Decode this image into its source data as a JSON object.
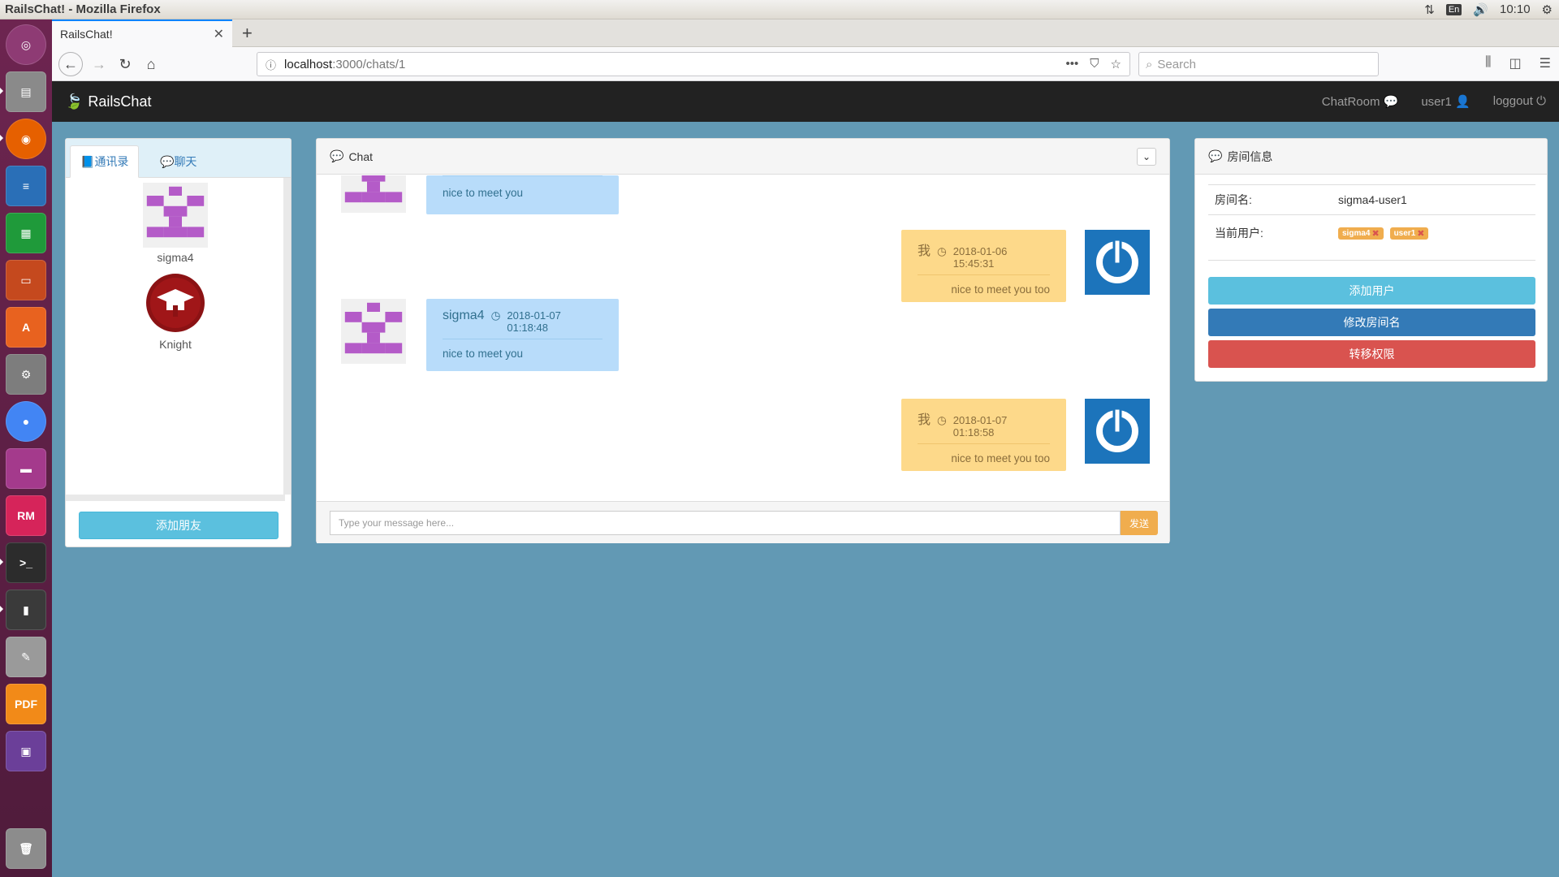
{
  "system": {
    "window_title": "RailsChat! - Mozilla Firefox",
    "lang": "En",
    "clock": "10:10"
  },
  "browser": {
    "tab_title": "RailsChat!",
    "url_host": "localhost",
    "url_path": ":3000/chats/1",
    "search_placeholder": "Search"
  },
  "app": {
    "brand": "RailsChat",
    "nav": {
      "chatroom": "ChatRoom",
      "user": "user1",
      "logout": "loggout"
    }
  },
  "left_panel": {
    "tabs": [
      "通讯录",
      "聊天"
    ],
    "contacts": [
      {
        "name": "sigma4"
      },
      {
        "name": "Knight"
      }
    ],
    "add_friend": "添加朋友"
  },
  "chat": {
    "title": "Chat",
    "messages": [
      {
        "side": "left",
        "name": "",
        "time": "",
        "text": "nice to meet you"
      },
      {
        "side": "right",
        "name": "我",
        "time": "2018-01-06 15:45:31",
        "text": "nice to meet you too"
      },
      {
        "side": "left",
        "name": "sigma4",
        "time": "2018-01-07 01:18:48",
        "text": "nice to meet you"
      },
      {
        "side": "right",
        "name": "我",
        "time": "2018-01-07 01:18:58",
        "text": "nice to meet you too"
      }
    ],
    "input_placeholder": "Type your message here...",
    "send": "发送"
  },
  "room": {
    "title": "房间信息",
    "name_label": "房间名:",
    "name_value": "sigma4-user1",
    "users_label": "当前用户:",
    "users": [
      "sigma4",
      "user1"
    ],
    "buttons": {
      "add_user": "添加用户",
      "rename": "修改房间名",
      "transfer": "转移权限"
    }
  },
  "colors": {
    "info": "#5bc0de",
    "primary": "#337ab7",
    "danger": "#d9534f",
    "warning": "#f0ad4e",
    "page_bg": "#6299b4"
  }
}
